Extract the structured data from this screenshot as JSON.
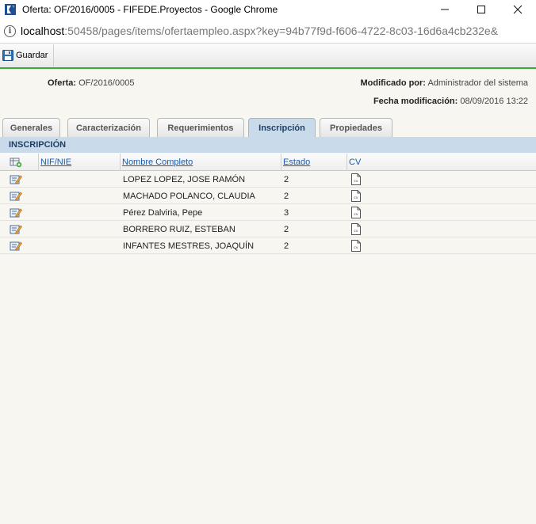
{
  "window": {
    "title": "Oferta: OF/2016/0005 - FIFEDE.Proyectos - Google Chrome",
    "minimize": "—",
    "maximize": "☐",
    "close": "✕"
  },
  "address": {
    "host": "localhost",
    "path": ":50458/pages/items/ofertaempleo.aspx?key=94b77f9d-f606-4722-8c03-16d6a4cb232e&"
  },
  "toolbar": {
    "save_label": "Guardar"
  },
  "header": {
    "oferta_label": "Oferta:",
    "oferta_value": "OF/2016/0005",
    "modificado_label": "Modificado por:",
    "modificado_value": "Administrador del sistema",
    "fecha_label": "Fecha modificación:",
    "fecha_value": "08/09/2016 13:22"
  },
  "tabs": [
    {
      "label": "Generales"
    },
    {
      "label": "Caracterización"
    },
    {
      "label": "Requerimientos"
    },
    {
      "label": "Inscripción"
    },
    {
      "label": "Propiedades"
    }
  ],
  "active_tab": "Inscripción",
  "section": {
    "title": "INSCRIPCIÓN"
  },
  "grid": {
    "columns": {
      "nif": "NIF/NIE",
      "nombre": "Nombre Completo",
      "estado": "Estado",
      "cv": "CV"
    },
    "rows": [
      {
        "nif": "",
        "nombre": "LOPEZ LOPEZ, JOSE RAMÓN",
        "estado": "2"
      },
      {
        "nif": "",
        "nombre": "MACHADO POLANCO, CLAUDIA",
        "estado": "2"
      },
      {
        "nif": "",
        "nombre": "Pérez Dalviria, Pepe",
        "estado": "3"
      },
      {
        "nif": "",
        "nombre": "BORRERO RUIZ, ESTEBAN",
        "estado": "2"
      },
      {
        "nif": "",
        "nombre": "INFANTES MESTRES, JOAQUÍN",
        "estado": "2"
      }
    ]
  },
  "colors": {
    "accent_green": "#3aaa38",
    "tab_active_bg": "#c9dbea",
    "link_blue": "#1a5ca8",
    "section_text": "#1f3f66"
  }
}
